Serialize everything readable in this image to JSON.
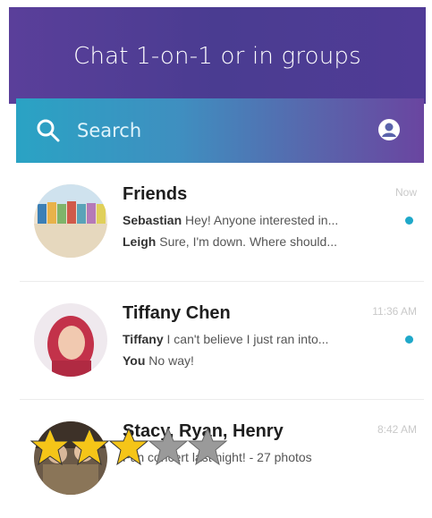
{
  "banner": {
    "title": "Chat 1-on-1 or in groups"
  },
  "search": {
    "placeholder": "Search"
  },
  "chats": [
    {
      "name": "Friends",
      "time": "Now",
      "unread": true,
      "lines": [
        {
          "sender": "Sebastian",
          "text": "Hey! Anyone interested in..."
        },
        {
          "sender": "Leigh",
          "text": "Sure, I'm down. Where should..."
        }
      ]
    },
    {
      "name": "Tiffany Chen",
      "time": "11:36 AM",
      "unread": true,
      "lines": [
        {
          "sender": "Tiffany",
          "text": "I can't believe I just ran into..."
        },
        {
          "sender": "You",
          "text": "No way!"
        }
      ]
    },
    {
      "name": "Stacy, Ryan, Henry",
      "time": "8:42 AM",
      "unread": false,
      "lines": [
        {
          "sender": "",
          "text": "Fun concert last night! - 27 photos"
        }
      ]
    }
  ],
  "rating": {
    "value": 3,
    "max": 5
  },
  "colors": {
    "accent": "#1fa8c9",
    "star_filled": "#f5c518",
    "star_empty": "#9a9a9a",
    "banner": "#4a3c91"
  }
}
